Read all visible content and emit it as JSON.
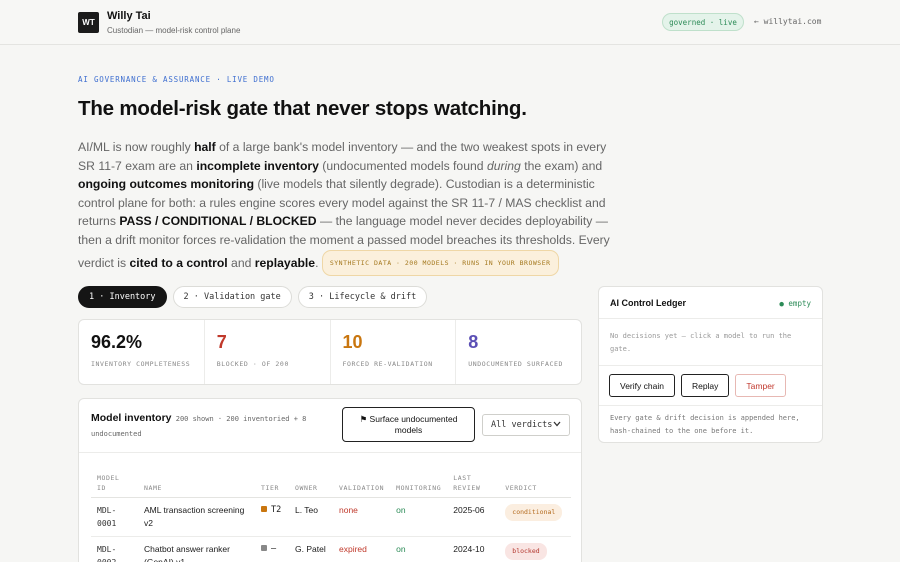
{
  "header": {
    "logo_initials": "WT",
    "name": "Willy Tai",
    "subtitle": "Custodian — model-risk control plane",
    "status_pill": "governed · live",
    "back_link": "← willytai.com"
  },
  "hero": {
    "eyebrow": "AI GOVERNANCE & ASSURANCE · LIVE DEMO",
    "headline": "The model-risk gate that never stops watching.",
    "intro": [
      {
        "t": "AI/ML is now roughly ",
        "s": "plain"
      },
      {
        "t": "half",
        "s": "bold"
      },
      {
        "t": " of a large bank's model inventory — and the two weakest spots in every SR 11-7 exam are an ",
        "s": "plain"
      },
      {
        "t": "incomplete inventory",
        "s": "bold"
      },
      {
        "t": " (undocumented models found ",
        "s": "plain"
      },
      {
        "t": "during",
        "s": "italic"
      },
      {
        "t": " the exam) and ",
        "s": "plain"
      },
      {
        "t": "ongoing outcomes monitoring",
        "s": "bold"
      },
      {
        "t": " (live models that silently degrade). Custodian is a deterministic control plane for both: a rules engine scores every model against the SR 11-7 / MAS checklist and returns ",
        "s": "plain"
      },
      {
        "t": "PASS / CONDITIONAL / BLOCKED",
        "s": "bold"
      },
      {
        "t": " — the language model never decides deployability — then a drift monitor forces re-validation the moment a passed model breaches its thresholds. Every verdict is ",
        "s": "plain"
      },
      {
        "t": "cited to a control",
        "s": "bold"
      },
      {
        "t": " and ",
        "s": "plain"
      },
      {
        "t": "replayable",
        "s": "bold"
      },
      {
        "t": ". ",
        "s": "plain"
      }
    ],
    "tag": "SYNTHETIC DATA · 200 MODELS · RUNS IN YOUR BROWSER"
  },
  "tabs": [
    {
      "label": "1 · Inventory",
      "active": true
    },
    {
      "label": "2 · Validation gate",
      "active": false
    },
    {
      "label": "3 · Lifecycle & drift",
      "active": false
    }
  ],
  "stats": [
    {
      "value": "96.2%",
      "label": "INVENTORY COMPLETENESS",
      "color": "#111111"
    },
    {
      "value": "7",
      "label": "BLOCKED · OF 200",
      "color": "#c0392b"
    },
    {
      "value": "10",
      "label": "FORCED RE-VALIDATION",
      "color": "#c9760f"
    },
    {
      "value": "8",
      "label": "UNDOCUMENTED SURFACED",
      "color": "#5b4fb5"
    }
  ],
  "inventory": {
    "title": "Model inventory",
    "meta": "200 shown · 200 inventoried + 8 undocumented",
    "surface_button": "⚑ Surface undocumented models",
    "filter_value": "All verdicts",
    "columns": [
      "MODEL ID",
      "NAME",
      "TIER",
      "OWNER",
      "VALIDATION",
      "MONITORING",
      "LAST REVIEW",
      "VERDICT"
    ],
    "rows": [
      {
        "id": "MDL-0001",
        "name": "AML transaction screening v2",
        "tier": "T2",
        "tier_color": "#c9760f",
        "owner": "L. Teo",
        "validation": "none",
        "validation_class": "val-none",
        "monitoring": "on",
        "last_review": "2025-06",
        "verdict": "conditional",
        "verdict_class": "v-conditional"
      },
      {
        "id": "MDL-0002",
        "name": "Chatbot answer ranker (GenAI) v1",
        "tier": "—",
        "tier_color": "#888888",
        "owner": "G. Patel",
        "validation": "expired",
        "validation_class": "val-expired",
        "monitoring": "on",
        "last_review": "2024-10",
        "verdict": "blocked",
        "verdict_class": "v-blocked"
      }
    ]
  },
  "ledger": {
    "title": "AI Control Ledger",
    "status": "● empty",
    "empty_text": "No decisions yet — click a model to run the gate.",
    "buttons": {
      "verify": "Verify chain",
      "replay": "Replay",
      "tamper": "Tamper"
    },
    "footer": "Every gate & drift decision is appended here, hash-chained to the one before it."
  }
}
